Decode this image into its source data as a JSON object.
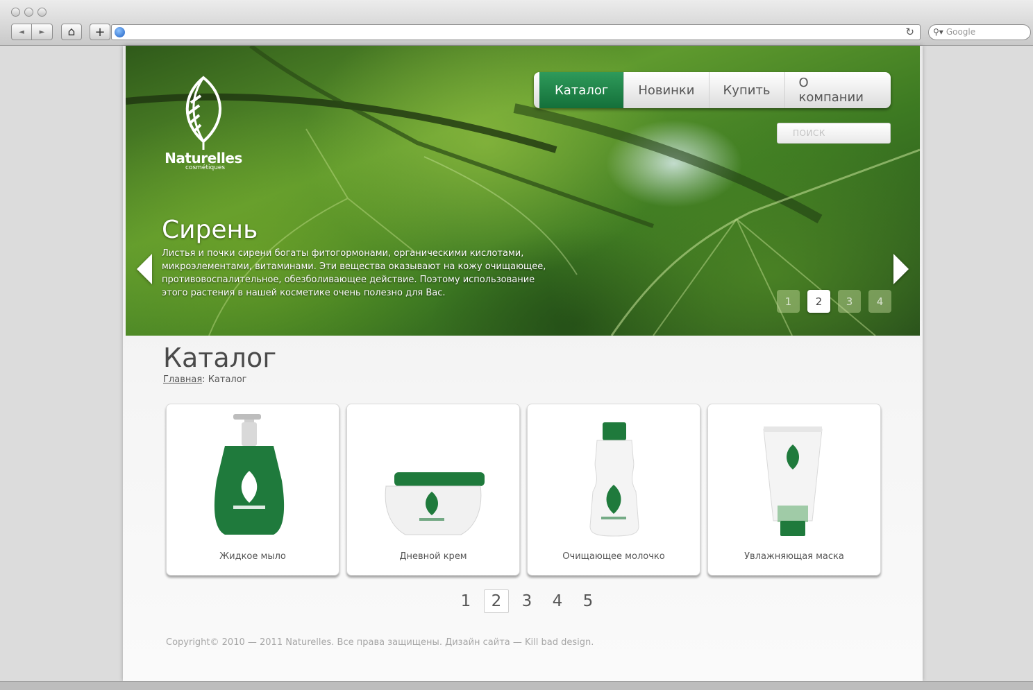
{
  "browser": {
    "search_placeholder": "Google",
    "nav_back": "◄",
    "nav_forward": "►",
    "home": "⌂",
    "add": "+",
    "reload": "↻"
  },
  "brand": {
    "name": "Naturelles",
    "subtitle": "cosmétiques"
  },
  "nav": {
    "items": [
      {
        "label": "Каталог",
        "active": true
      },
      {
        "label": "Новинки",
        "active": false
      },
      {
        "label": "Купить",
        "active": false
      },
      {
        "label": "О компании",
        "active": false
      }
    ]
  },
  "search": {
    "placeholder": "поиск"
  },
  "slider": {
    "title": "Сирень",
    "text": "Листья и почки сирени богаты фитогормонами, органическими кислотами, микроэлементами, витаминами. Эти вещества оказывают на кожу очищающее, противовоспалительное, обезболивающее действие. Поэтому использование этого растения в нашей косметике очень полезно для Вас.",
    "dots": [
      "1",
      "2",
      "3",
      "4"
    ],
    "active_dot": 2
  },
  "catalog": {
    "title": "Каталог",
    "breadcrumb_home": "Главная",
    "breadcrumb_sep": ":",
    "breadcrumb_current": "Каталог",
    "products": [
      {
        "name": "Жидкое мыло"
      },
      {
        "name": "Дневной крем"
      },
      {
        "name": "Очищающее молочко"
      },
      {
        "name": "Увлажняющая маска"
      }
    ]
  },
  "pagination": {
    "pages": [
      "1",
      "2",
      "3",
      "4",
      "5"
    ],
    "active": 2
  },
  "footer": {
    "text": "Copyright© 2010 — 2011 Naturelles. Все права защищены. Дизайн сайта — Kill bad design."
  },
  "colors": {
    "accent_green": "#14703a",
    "footer_text": "#a6a6a6"
  }
}
